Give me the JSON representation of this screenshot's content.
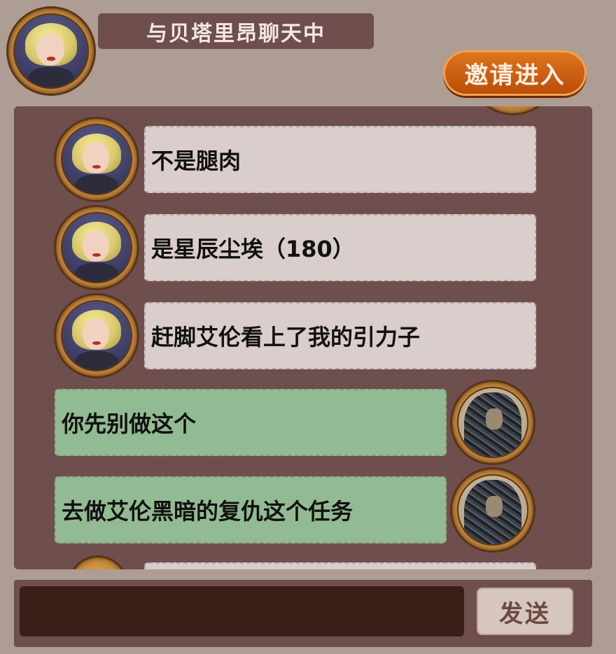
{
  "header": {
    "title": "与贝塔里昂聊天中",
    "invite_label": "邀请进入"
  },
  "messages": [
    {
      "side": "other",
      "text": "不是腿肉"
    },
    {
      "side": "other",
      "text": "是星辰尘埃（180）"
    },
    {
      "side": "other",
      "text": "赶脚艾伦看上了我的引力子"
    },
    {
      "side": "self",
      "text": "你先别做这个"
    },
    {
      "side": "self",
      "text": "去做艾伦黑暗的复仇这个任务"
    }
  ],
  "composer": {
    "input_value": "",
    "send_label": "发送"
  }
}
